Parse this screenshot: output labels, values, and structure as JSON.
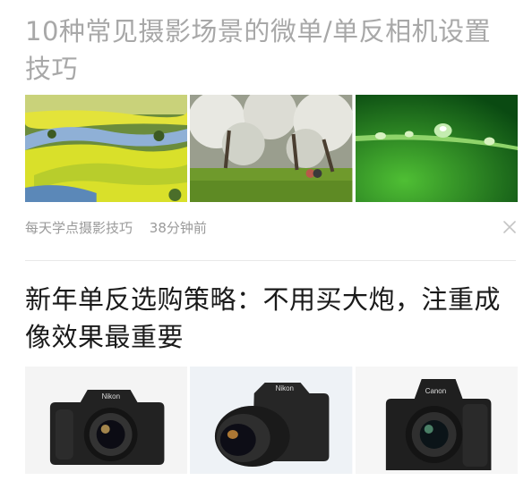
{
  "feed": {
    "articles": [
      {
        "title": "10种常见摄影场景的微单/单反相机设置技巧",
        "images": [
          {
            "name": "canola-field-river-thumbnail",
            "alt": "rapeseed fields along a river"
          },
          {
            "name": "blossom-orchard-thumbnail",
            "alt": "blossoming trees in an orchard"
          },
          {
            "name": "water-droplets-leaf-thumbnail",
            "alt": "dew drops on a green leaf"
          }
        ],
        "source": "每天学点摄影技巧",
        "time": "38分钟前"
      },
      {
        "title": "新年单反选购策略：不用买大炮，注重成像效果最重要",
        "images": [
          {
            "name": "nikon-camera-front-thumbnail",
            "alt": "Nikon DSLR camera"
          },
          {
            "name": "nikon-camera-zoom-lens-thumbnail",
            "alt": "Nikon DSLR with zoom lens"
          },
          {
            "name": "canon-camera-grip-thumbnail",
            "alt": "Canon DSLR with battery grip"
          }
        ],
        "brand_labels": [
          "Nikon",
          "Nikon",
          "Canon"
        ]
      }
    ]
  },
  "colors": {
    "read_title": "#a8a8a8",
    "unread_title": "#1a1a1a",
    "meta_text": "#9a9a9a",
    "divider": "#e8e8e8"
  }
}
